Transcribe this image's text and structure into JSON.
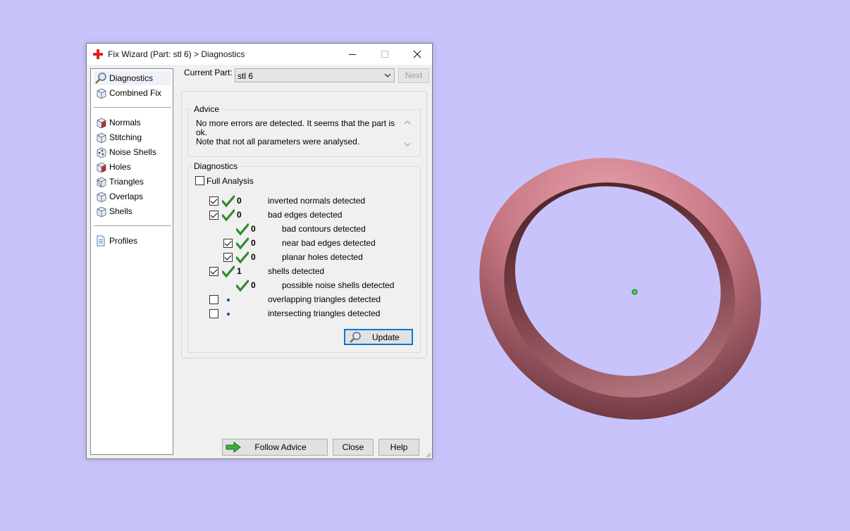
{
  "window": {
    "title": "Fix Wizard (Part: stl 6) > Diagnostics",
    "icons": {
      "app": "red-cross-icon",
      "minimize": "minimize-icon",
      "maximize": "maximize-icon",
      "close": "close-icon"
    }
  },
  "nav": {
    "items": [
      {
        "label": "Diagnostics",
        "icon": "magnifier-icon",
        "selected": true
      },
      {
        "label": "Combined Fix",
        "icon": "cube-icon"
      },
      {
        "label": "Normals",
        "icon": "cube-red-icon"
      },
      {
        "label": "Stitching",
        "icon": "cube-icon"
      },
      {
        "label": "Noise Shells",
        "icon": "noise-shells-icon"
      },
      {
        "label": "Holes",
        "icon": "cube-red-icon"
      },
      {
        "label": "Triangles",
        "icon": "cube-icon"
      },
      {
        "label": "Overlaps",
        "icon": "cube-icon"
      },
      {
        "label": "Shells",
        "icon": "cube-icon"
      },
      {
        "label": "Profiles",
        "icon": "document-icon"
      }
    ]
  },
  "current_part": {
    "label": "Current Part:",
    "value": "stl 6"
  },
  "next_label": "Next",
  "advice": {
    "title": "Advice",
    "line1": "No more errors are detected. It seems that the part is ok.",
    "line2": "Note that not all parameters were analysed."
  },
  "diagnostics": {
    "title": "Diagnostics",
    "full_analysis": "Full Analysis",
    "rows": [
      {
        "checkbox": true,
        "checked": true,
        "status": "ok",
        "value": "0",
        "label": "inverted normals detected"
      },
      {
        "checkbox": true,
        "checked": true,
        "status": "ok",
        "value": "0",
        "label": "bad edges detected"
      },
      {
        "checkbox": false,
        "status": "ok",
        "value": "0",
        "label": "bad contours detected"
      },
      {
        "checkbox": true,
        "checked": true,
        "status": "ok",
        "value": "0",
        "label": "near bad edges detected"
      },
      {
        "checkbox": true,
        "checked": true,
        "status": "ok",
        "value": "0",
        "label": "planar holes detected"
      },
      {
        "checkbox": true,
        "checked": true,
        "status": "ok",
        "value": "1",
        "label": "shells detected"
      },
      {
        "checkbox": false,
        "status": "ok",
        "value": "0",
        "label": "possible noise shells detected"
      },
      {
        "checkbox": true,
        "checked": false,
        "status": "pending",
        "value": "",
        "label": "overlapping triangles detected"
      },
      {
        "checkbox": true,
        "checked": false,
        "status": "pending",
        "value": "",
        "label": "intersecting triangles detected"
      }
    ],
    "update_label": "Update"
  },
  "buttons": {
    "follow_advice": "Follow Advice",
    "close": "Close",
    "help": "Help"
  },
  "colors": {
    "viewport_bg": "#c8c4fb",
    "ring": "#c97a86",
    "check_green": "#2e8b2e",
    "focus_blue": "#0078d7"
  }
}
